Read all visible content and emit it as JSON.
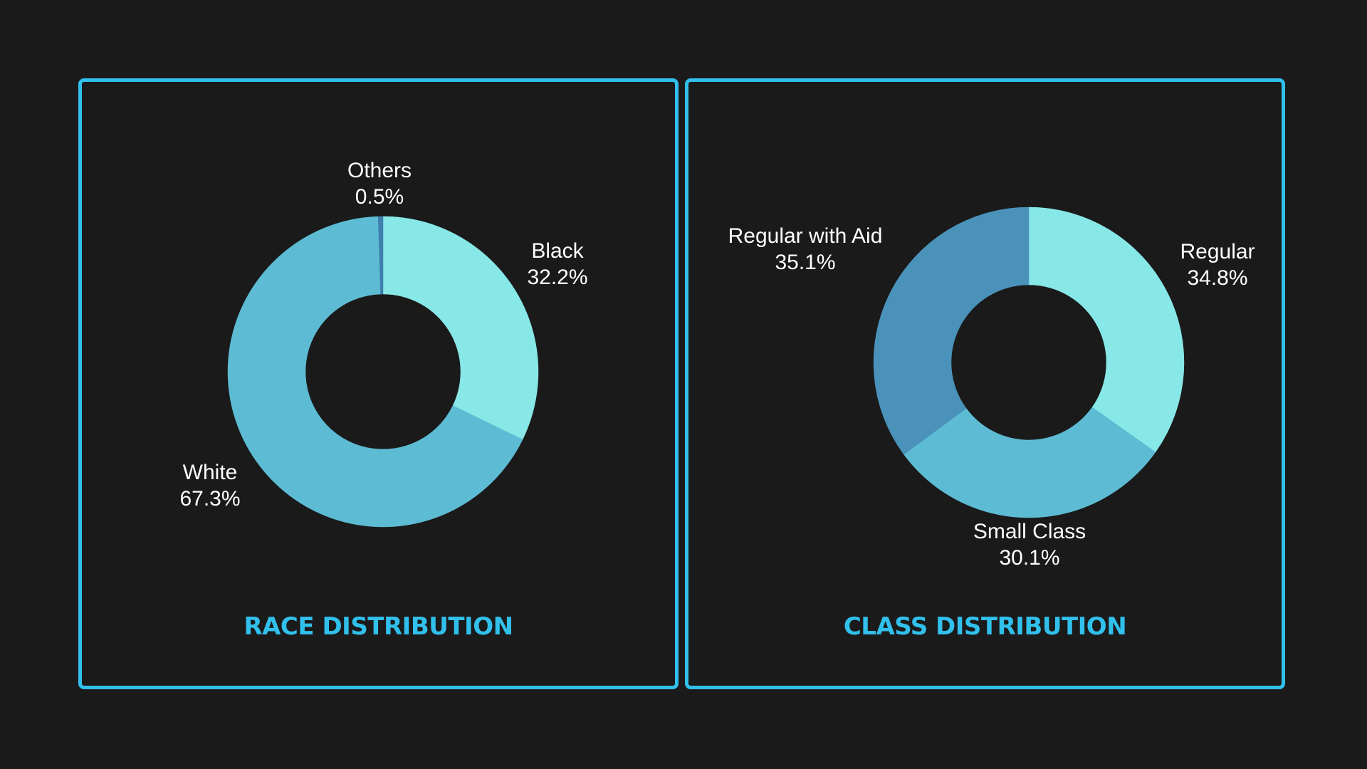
{
  "colors": {
    "background": "#1a1a1a",
    "border": "#31c0ec",
    "title": "#31c0ec",
    "label": "#ffffff",
    "slice_light": "#88e8e8",
    "slice_mid": "#5dbcd4",
    "slice_dark": "#4a92ba",
    "slice_darkest": "#3e7fae"
  },
  "chart_data": [
    {
      "type": "pie",
      "style": "donut",
      "title": "RACE DISTRIBUTION",
      "categories": [
        "Black",
        "White",
        "Others"
      ],
      "values": [
        32.2,
        67.3,
        0.5
      ],
      "value_labels": [
        "32.2%",
        "67.3%",
        "0.5%"
      ],
      "colors": [
        "#88e8e8",
        "#5dbcd4",
        "#3e7fae"
      ],
      "start": "12 o'clock",
      "direction": "clockwise"
    },
    {
      "type": "pie",
      "style": "donut",
      "title": "CLASS DISTRIBUTION",
      "categories": [
        "Regular",
        "Small Class",
        "Regular with Aid"
      ],
      "values": [
        34.8,
        30.1,
        35.1
      ],
      "value_labels": [
        "34.8%",
        "30.1%",
        "35.1%"
      ],
      "colors": [
        "#88e8e8",
        "#5dbcd4",
        "#4a92ba"
      ],
      "start": "12 o'clock",
      "direction": "clockwise"
    }
  ]
}
